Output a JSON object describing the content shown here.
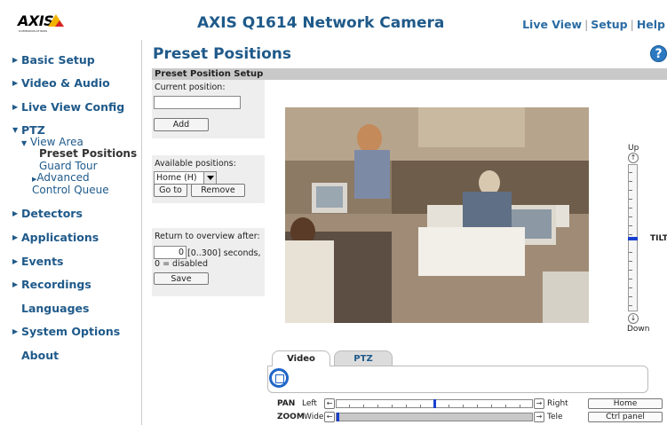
{
  "logo": {
    "text": "AXIS",
    "tagline": "COMMUNICATIONS"
  },
  "header": {
    "title": "AXIS Q1614 Network Camera",
    "nav": [
      "Live View",
      "Setup",
      "Help"
    ]
  },
  "sidebar": {
    "items": [
      {
        "label": "Basic Setup",
        "expanded": false
      },
      {
        "label": "Video & Audio",
        "expanded": false
      },
      {
        "label": "Live View Config",
        "expanded": false
      },
      {
        "label": "PTZ",
        "expanded": true
      },
      {
        "label": "Detectors",
        "expanded": false
      },
      {
        "label": "Applications",
        "expanded": false
      },
      {
        "label": "Events",
        "expanded": false
      },
      {
        "label": "Recordings",
        "expanded": false
      },
      {
        "label": "Languages",
        "expanded": null
      },
      {
        "label": "System Options",
        "expanded": false
      },
      {
        "label": "About",
        "expanded": null
      }
    ],
    "ptz_children": {
      "view_area": "View Area",
      "preset_positions": "Preset Positions",
      "guard_tour": "Guard Tour",
      "advanced": "Advanced",
      "control_queue": "Control Queue"
    }
  },
  "page": {
    "title": "Preset Positions",
    "help_icon": "?",
    "section_title": "Preset Position Setup"
  },
  "current_position": {
    "label": "Current position:",
    "value": "",
    "add_label": "Add"
  },
  "available_positions": {
    "label": "Available positions:",
    "selected": "Home (H)",
    "goto_label": "Go to",
    "remove_label": "Remove"
  },
  "return_overview": {
    "label": "Return to overview after:",
    "value": "0",
    "range": "[0..300] seconds,",
    "note": "0 = disabled",
    "save_label": "Save"
  },
  "tilt": {
    "up_label": "Up",
    "down_label": "Down",
    "axis_label": "TILT",
    "level": 0.5
  },
  "tabs": [
    "Video",
    "PTZ"
  ],
  "pan": {
    "label": "PAN",
    "left": "Left",
    "right": "Right",
    "level": 0.5
  },
  "zoom": {
    "label": "ZOOM",
    "wide": "Wide",
    "tele": "Tele",
    "level": 0.0
  },
  "buttons": {
    "home": "Home",
    "ctrl_panel": "Ctrl panel"
  },
  "colors": {
    "brand_blue": "#1f5a8a",
    "slider_handle": "#1a3fd0",
    "section_bar": "#c9c9c9"
  }
}
